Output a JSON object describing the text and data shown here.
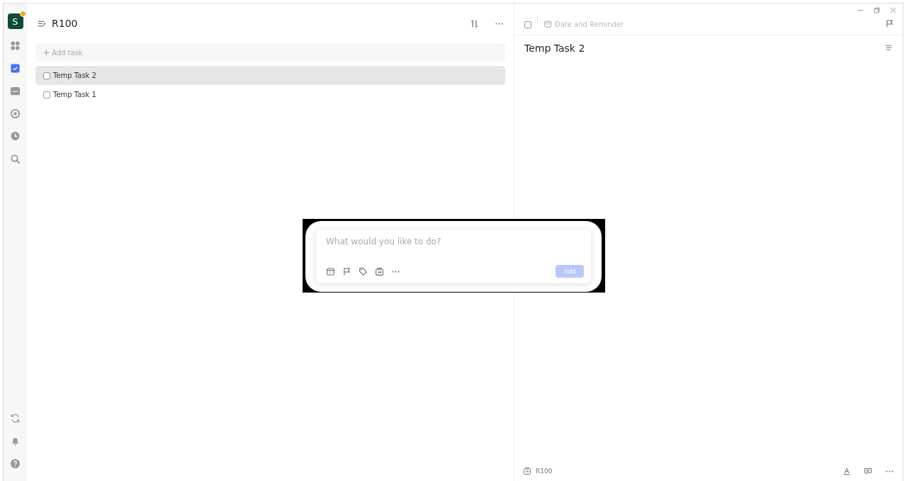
{
  "sidebar": {
    "avatar": "S",
    "items": [
      {
        "kind": "grid",
        "selected": false
      },
      {
        "kind": "tasks",
        "selected": true
      },
      {
        "kind": "calendar",
        "selected": false
      },
      {
        "kind": "target",
        "selected": false
      },
      {
        "kind": "clock",
        "selected": false
      },
      {
        "kind": "search",
        "selected": false
      }
    ],
    "bottom_items": [
      {
        "kind": "sync"
      },
      {
        "kind": "bell"
      },
      {
        "kind": "help"
      }
    ]
  },
  "list": {
    "title": "R100",
    "add_task_placeholder": "Add task",
    "tasks": [
      {
        "title": "Temp Task 2",
        "checked": false,
        "selected": true
      },
      {
        "title": "Temp Task 1",
        "checked": false,
        "selected": false
      }
    ]
  },
  "detail": {
    "checked": false,
    "date_placeholder": "Date and Reminder",
    "title": "Temp Task 2",
    "list_name": "R100"
  },
  "quick_add": {
    "placeholder": "What would you like to do?",
    "add_button": "Add",
    "add_disabled": true
  }
}
